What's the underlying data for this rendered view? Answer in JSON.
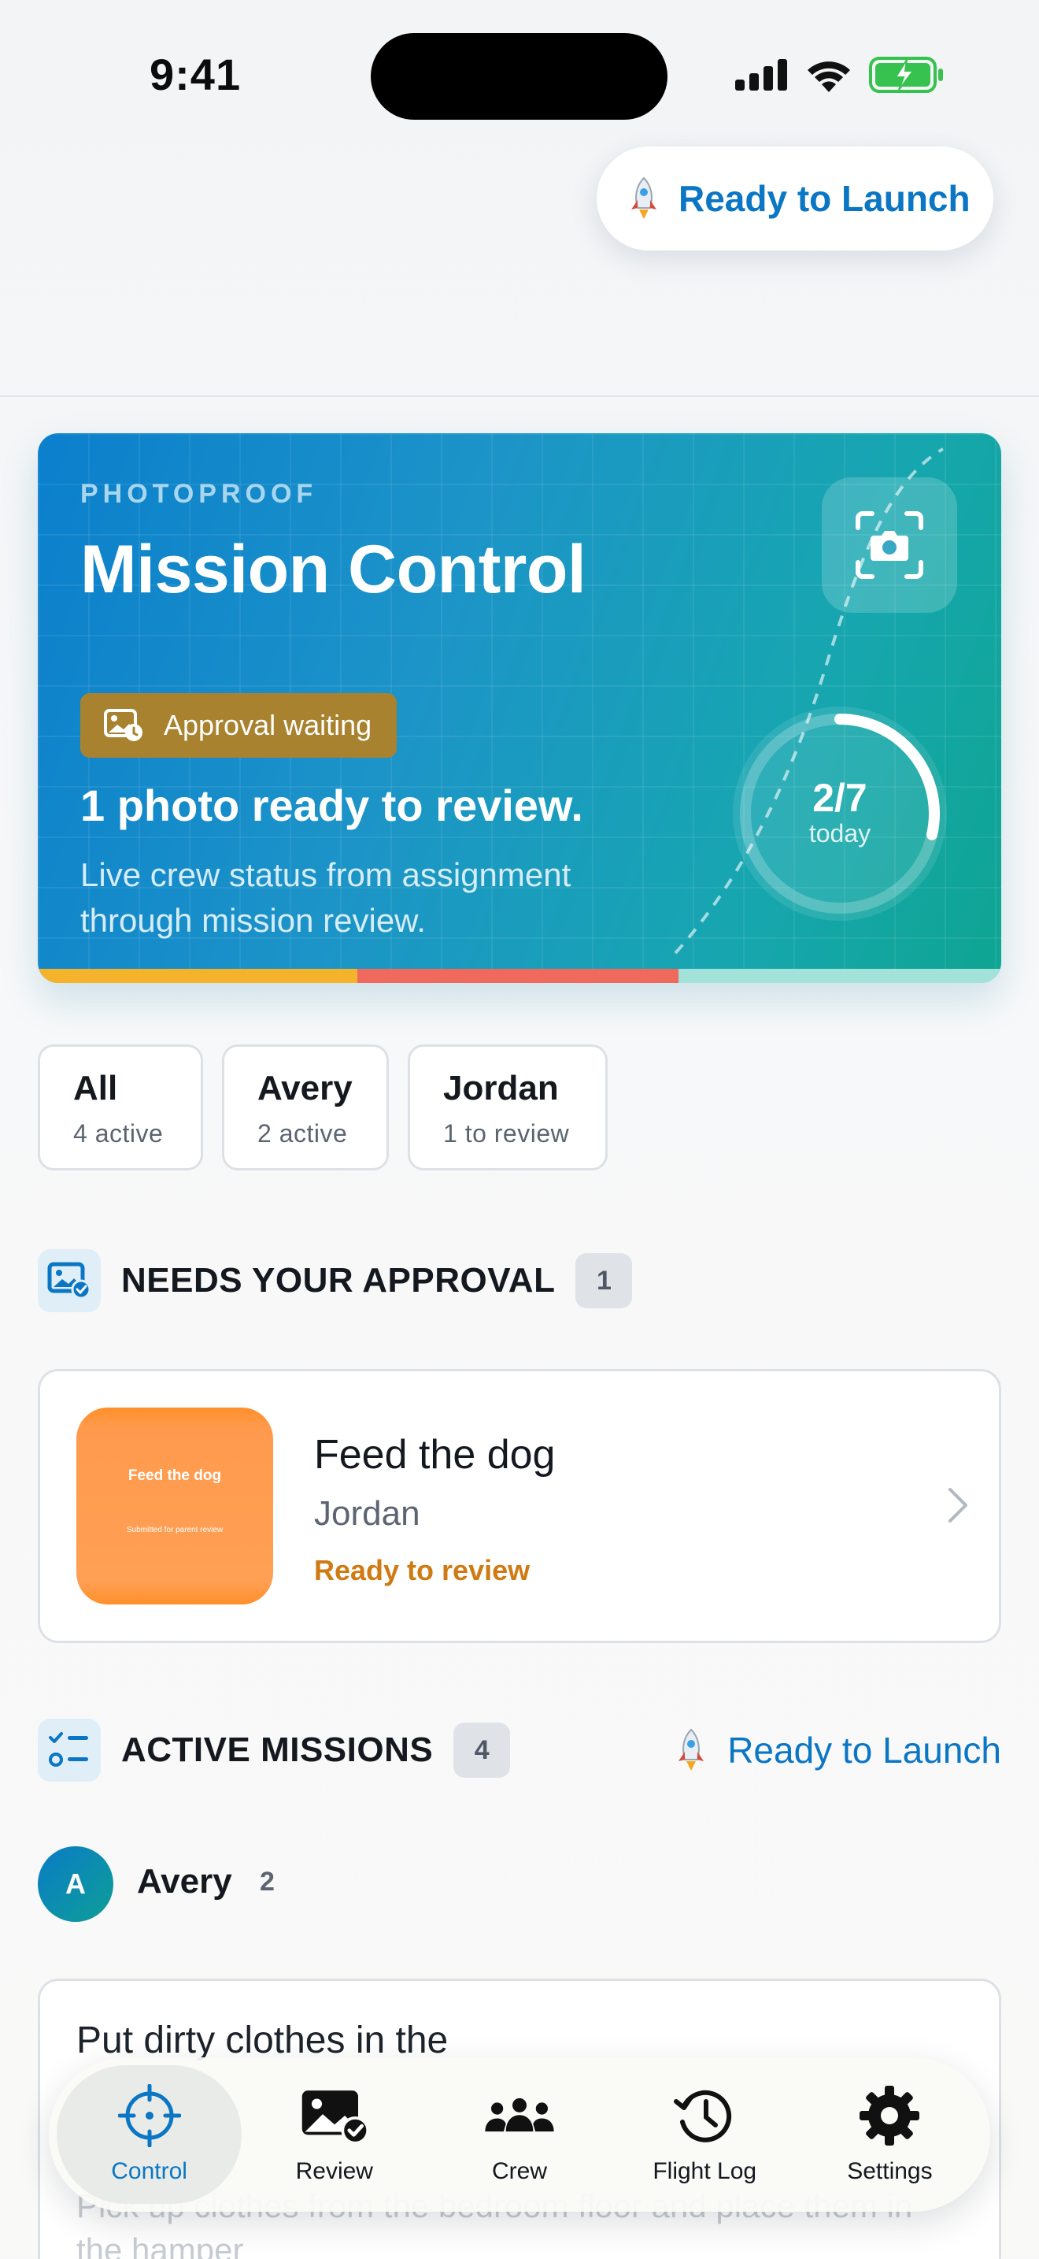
{
  "status_bar": {
    "time": "9:41"
  },
  "launch_pill": {
    "label": "Ready to Launch",
    "icon": "rocket-icon"
  },
  "hero": {
    "eyebrow": "PHOTOPROOF",
    "title": "Mission Control",
    "camera_icon": "camera-scan-icon",
    "chip": {
      "label": "Approval waiting",
      "icon": "photo-clock-icon"
    },
    "headline": "1 photo ready to review.",
    "subtitle": "Live crew status from assignment through mission review.",
    "progress": {
      "count": "2/7",
      "unit": "today",
      "done": 2,
      "total": 7
    },
    "status_bar_colors": [
      "#f4b32a",
      "#ef6a5c",
      "#a3e2d9"
    ]
  },
  "filters": [
    {
      "name": "All",
      "meta": "4 active",
      "active": true
    },
    {
      "name": "Avery",
      "meta": "2 active",
      "active": false
    },
    {
      "name": "Jordan",
      "meta": "1 to review",
      "active": false
    }
  ],
  "approval_section": {
    "title": "NEEDS YOUR APPROVAL",
    "count": "1",
    "icon": "photo-check-icon"
  },
  "review_item": {
    "thumb_title": "Feed the dog",
    "thumb_caption": "Submitted for parent review",
    "title": "Feed the dog",
    "assignee": "Jordan",
    "status": "Ready to review"
  },
  "missions_section": {
    "title": "ACTIVE MISSIONS",
    "count": "4",
    "icon": "checklist-icon",
    "action_label": "Ready to Launch"
  },
  "crew_member": {
    "initial": "A",
    "name": "Avery",
    "count": "2"
  },
  "mission_card": {
    "title": "Put dirty clothes in the",
    "description": "Pick up clothes from the bedroom floor and place them in the hamper"
  },
  "tabs": [
    {
      "label": "Control",
      "icon": "crosshair-icon",
      "active": true
    },
    {
      "label": "Review",
      "icon": "photo-check-icon",
      "active": false
    },
    {
      "label": "Crew",
      "icon": "people-icon",
      "active": false
    },
    {
      "label": "Flight Log",
      "icon": "history-icon",
      "active": false
    },
    {
      "label": "Settings",
      "icon": "gear-icon",
      "active": false
    }
  ],
  "colors": {
    "accent": "#0a76c4",
    "review_status": "#cf7a12",
    "chip": "#a8822e"
  }
}
